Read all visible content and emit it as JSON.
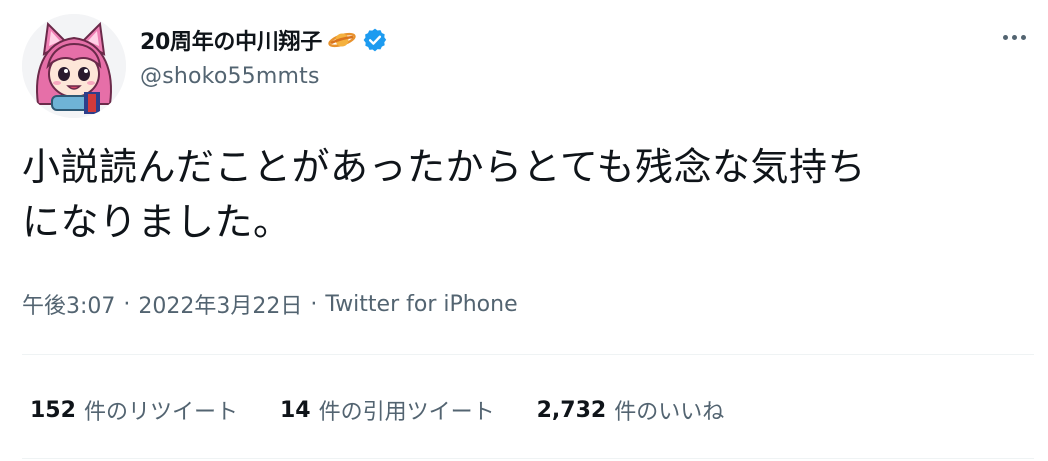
{
  "author": {
    "display_name": "20周年の中川翔子",
    "handle": "@shoko55mmts",
    "avatar_icon": "cat-eared-pink-hair-avatar-icon",
    "name_emoji_icon": "ringed-planet-icon",
    "verified_icon": "verified-badge-icon"
  },
  "tweet": {
    "text": "小説読んだことがあったからとても残念な気持ち\nになりました。"
  },
  "meta": {
    "time": "午後3:07",
    "separator": "·",
    "date": "2022年3月22日",
    "source": "Twitter for iPhone"
  },
  "stats": [
    {
      "count": "152",
      "label": "件のリツイート"
    },
    {
      "count": "14",
      "label": "件の引用ツイート"
    },
    {
      "count": "2,732",
      "label": "件のいいね"
    }
  ],
  "colors": {
    "text_primary": "#0f1419",
    "text_secondary": "#536471",
    "verified_blue": "#1d9bf0",
    "divider": "#eff3f4"
  }
}
